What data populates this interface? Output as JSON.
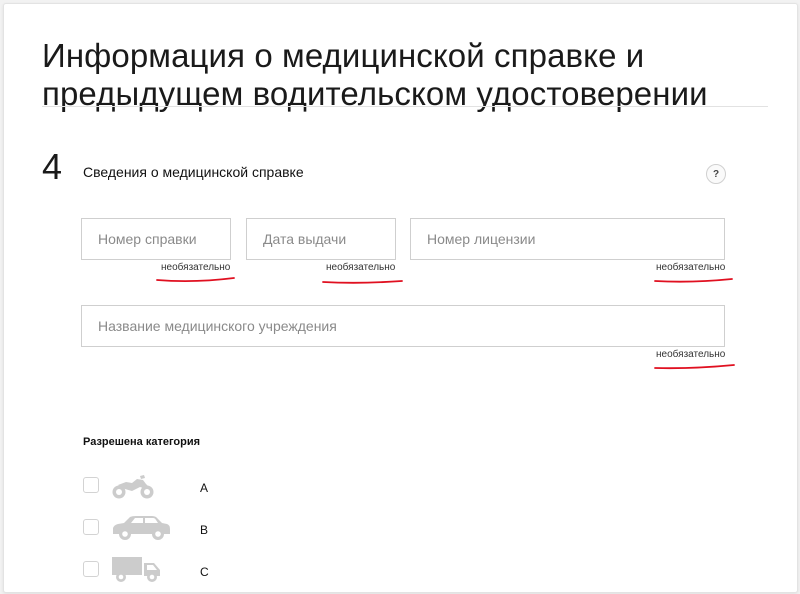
{
  "header": {
    "title_line1": "Информация о медицинской справке и",
    "title_line2": "предыдущем водительском удостоверении"
  },
  "section": {
    "number": "4",
    "title": "Сведения о медицинской справке",
    "help_label": "?"
  },
  "fields": {
    "certificate_number": {
      "placeholder": "Номер справки",
      "value": "",
      "hint": "необязательно"
    },
    "issue_date": {
      "placeholder": "Дата выдачи",
      "value": "",
      "hint": "необязательно"
    },
    "license_number": {
      "placeholder": "Номер лицензии",
      "value": "",
      "hint": "необязательно"
    },
    "institution_name": {
      "placeholder": "Название медицинского учреждения",
      "value": "",
      "hint": "необязательно"
    }
  },
  "colors": {
    "annotation_underline": "#e01020",
    "icon_gray": "#cccccc"
  },
  "categories": {
    "title": "Разрешена категория",
    "items": [
      {
        "label": "A",
        "icon": "motorcycle-icon",
        "checked": false
      },
      {
        "label": "B",
        "icon": "car-icon",
        "checked": false
      },
      {
        "label": "C",
        "icon": "truck-icon",
        "checked": false
      }
    ]
  }
}
